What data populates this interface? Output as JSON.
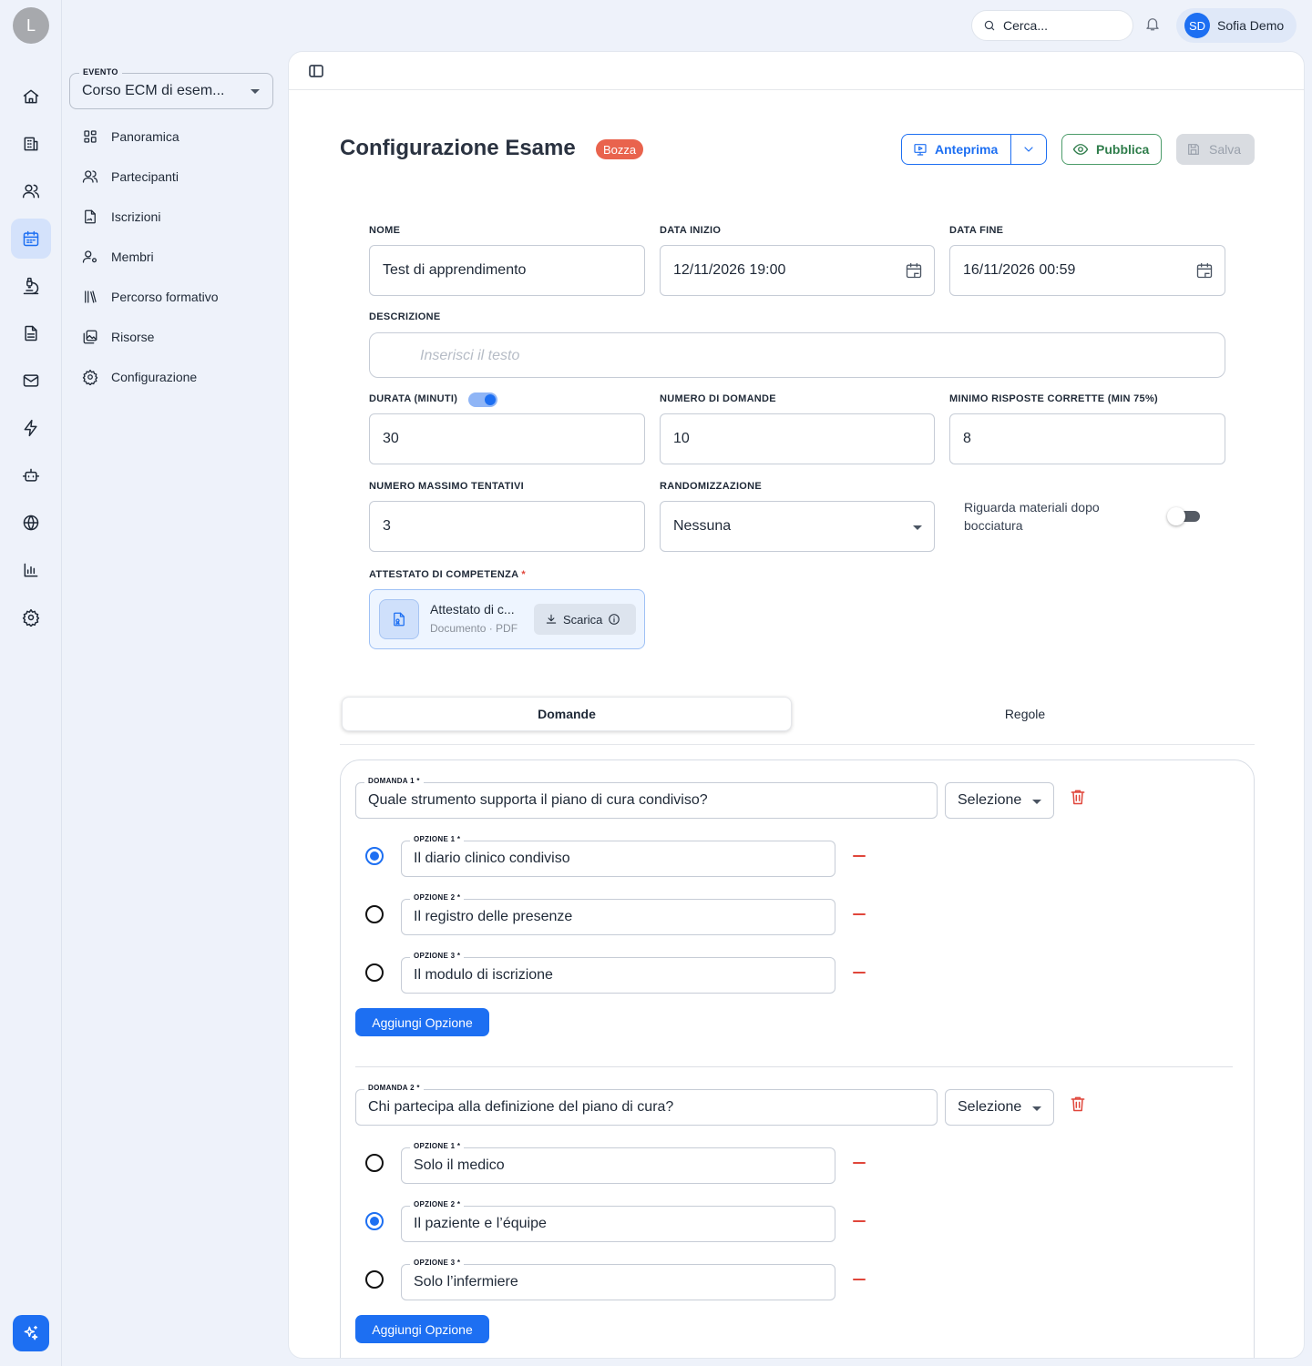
{
  "rail": {
    "avatar_initial": "L",
    "items": [
      "home-icon",
      "building-icon",
      "users-icon",
      "calendar-icon",
      "microscope-icon",
      "document-icon",
      "mail-icon",
      "bolt-icon",
      "robot-icon",
      "globe-icon",
      "bar-chart-icon",
      "gear-icon"
    ],
    "active_item": "calendar-icon",
    "fab_icon": "sparkles-icon"
  },
  "topbar": {
    "search_placeholder": "Cerca...",
    "user_initials": "SD",
    "user_name": "Sofia Demo"
  },
  "sidebar": {
    "event_label": "EVENTO",
    "event_value": "Corso ECM di esem...",
    "items": [
      {
        "label": "Panoramica",
        "icon": "grid-icon"
      },
      {
        "label": "Partecipanti",
        "icon": "users-icon"
      },
      {
        "label": "Iscrizioni",
        "icon": "file-signature-icon"
      },
      {
        "label": "Membri",
        "icon": "user-cog-icon"
      },
      {
        "label": "Percorso formativo",
        "icon": "library-icon"
      },
      {
        "label": "Risorse",
        "icon": "images-icon"
      },
      {
        "label": "Configurazione",
        "icon": "gear-icon"
      }
    ]
  },
  "header": {
    "title": "Configurazione Esame",
    "status_badge": "Bozza",
    "preview_label": "Anteprima",
    "publish_label": "Pubblica",
    "save_label": "Salva"
  },
  "form": {
    "name_label": "NOME",
    "name_value": "Test di apprendimento",
    "start_label": "DATA INIZIO",
    "start_value": "12/11/2026 19:00",
    "end_label": "DATA FINE",
    "end_value": "16/11/2026 00:59",
    "description_label": "DESCRIZIONE",
    "description_placeholder": "Inserisci il testo",
    "duration_label": "DURATA (MINUTI)",
    "duration_enabled": true,
    "duration_value": "30",
    "questions_count_label": "NUMERO DI DOMANDE",
    "questions_count_value": "10",
    "min_correct_label": "MINIMO RISPOSTE CORRETTE (MIN 75%)",
    "min_correct_value": "8",
    "max_attempts_label": "NUMERO MASSIMO TENTATIVI",
    "max_attempts_value": "3",
    "randomization_label": "RANDOMIZZAZIONE",
    "randomization_value": "Nessuna",
    "review_materials_label": "Riguarda materiali dopo bocciatura",
    "review_materials_enabled": false,
    "certificate_label": "ATTESTATO DI COMPETENZA",
    "certificate_required_mark": "*",
    "certificate_name": "Attestato di c...",
    "certificate_meta": "Documento · PDF",
    "download_label": "Scarica"
  },
  "tabs": [
    {
      "label": "Domande",
      "active": true
    },
    {
      "label": "Regole",
      "active": false
    }
  ],
  "questions": [
    {
      "label": "DOMANDA 1 *",
      "text": "Quale strumento supporta il piano di cura condiviso?",
      "type": "Selezione",
      "options": [
        {
          "label": "OPZIONE 1 *",
          "text": "Il diario clinico condiviso",
          "correct": true
        },
        {
          "label": "OPZIONE 2 *",
          "text": "Il registro delle presenze",
          "correct": false
        },
        {
          "label": "OPZIONE 3 *",
          "text": "Il modulo di iscrizione",
          "correct": false
        }
      ],
      "add_option_label": "Aggiungi Opzione"
    },
    {
      "label": "DOMANDA 2 *",
      "text": "Chi partecipa alla definizione del piano di cura?",
      "type": "Selezione",
      "options": [
        {
          "label": "OPZIONE 1 *",
          "text": "Solo il medico",
          "correct": false
        },
        {
          "label": "OPZIONE 2 *",
          "text": "Il paziente e l’équipe",
          "correct": true
        },
        {
          "label": "OPZIONE 3 *",
          "text": "Solo l’infermiere",
          "correct": false
        }
      ],
      "add_option_label": "Aggiungi Opzione"
    }
  ],
  "colors": {
    "accent": "#1d6ff2",
    "badge": "#e9634d",
    "publish": "#2f7d4b",
    "danger": "#e0463b"
  }
}
